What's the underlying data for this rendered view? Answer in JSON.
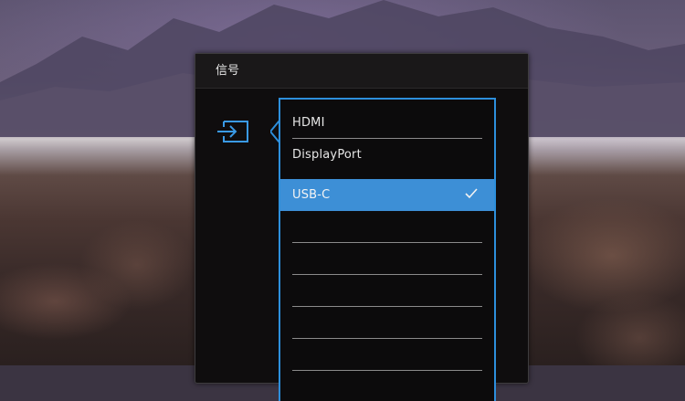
{
  "osd": {
    "title": "信号",
    "input_icon": "input-source-icon",
    "inputs": [
      {
        "label": "HDMI",
        "selected": false
      },
      {
        "label": "DisplayPort",
        "selected": false
      },
      {
        "label": "USB-C",
        "selected": true
      }
    ],
    "empty_slots": 5,
    "selected_check_icon": "checkmark-icon",
    "colors": {
      "accent": "#2d8fdc",
      "selected_bg": "#3d8fd6",
      "panel_bg": "#0f0d0e",
      "text": "#e6e6e6"
    }
  }
}
